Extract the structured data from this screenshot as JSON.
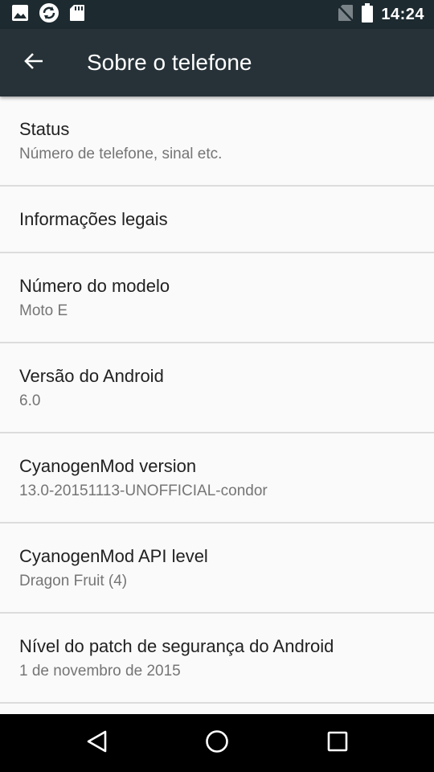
{
  "status_bar": {
    "time": "14:24",
    "left_icons": [
      "image-icon",
      "sync-icon",
      "sd-card-icon"
    ],
    "right_icons": [
      "no-sim-icon",
      "battery-icon"
    ]
  },
  "app_bar": {
    "title": "Sobre o telefone",
    "back_icon": "arrow-back-icon",
    "background": "#263238"
  },
  "items": [
    {
      "title": "Status",
      "subtitle": "Número de telefone, sinal etc."
    },
    {
      "title": "Informações legais"
    },
    {
      "title": "Número do modelo",
      "subtitle": "Moto E"
    },
    {
      "title": "Versão do Android",
      "subtitle": "6.0"
    },
    {
      "title": "CyanogenMod version",
      "subtitle": "13.0-20151113-UNOFFICIAL-condor"
    },
    {
      "title": "CyanogenMod API level",
      "subtitle": "Dragon Fruit (4)"
    },
    {
      "title": "Nível do patch de segurança do Android",
      "subtitle": "1 de novembro de 2015"
    }
  ],
  "nav_bar": {
    "buttons": [
      "back-triangle-icon",
      "home-circle-icon",
      "recents-square-icon"
    ]
  }
}
